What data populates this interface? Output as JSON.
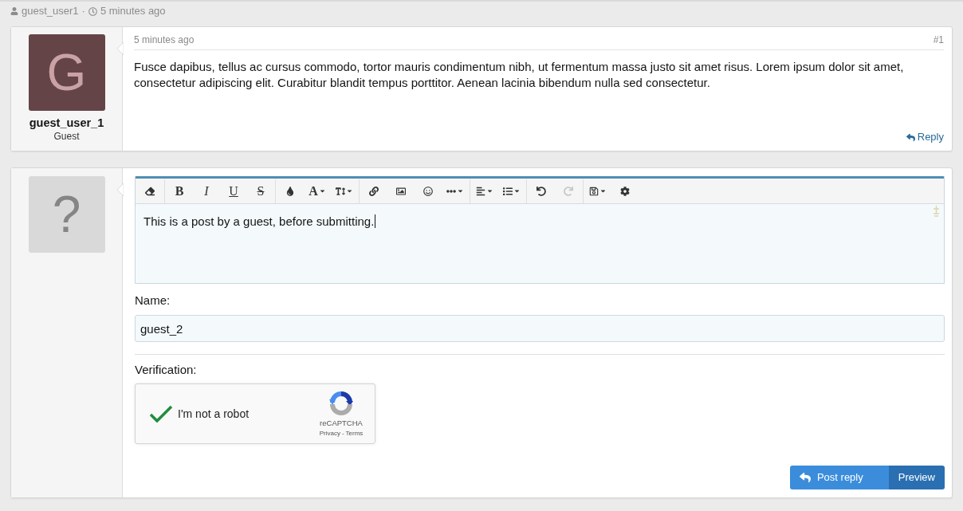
{
  "thread_meta": {
    "author": "guest_user1",
    "separator": "·",
    "time": "5 minutes ago"
  },
  "posts": [
    {
      "avatar_letter": "G",
      "username": "guest_user_1",
      "user_title": "Guest",
      "time": "5 minutes ago",
      "number": "#1",
      "body": "Fusce dapibus, tellus ac cursus commodo, tortor mauris condimentum nibh, ut fermentum massa justo sit amet risus. Lorem ipsum dolor sit amet, consectetur adipiscing elit. Curabitur blandit tempus porttitor. Aenean lacinia bibendum nulla sed consectetur.",
      "reply_link": "Reply"
    }
  ],
  "reply_form": {
    "avatar_placeholder": "?",
    "toolbar": [
      [
        {
          "dropdown": false,
          "disabled": false
        }
      ],
      [
        {
          "label": "B",
          "dropdown": false,
          "disabled": false
        },
        {
          "label": "I",
          "dropdown": false,
          "disabled": false
        },
        {
          "label": "U",
          "dropdown": false,
          "disabled": false
        },
        {
          "label": "S",
          "dropdown": false,
          "disabled": false
        }
      ],
      [
        {
          "dropdown": false,
          "disabled": false
        },
        {
          "label": "A",
          "dropdown": true,
          "disabled": false
        },
        {
          "dropdown": true,
          "disabled": false
        }
      ],
      [
        {
          "dropdown": false,
          "disabled": false
        },
        {
          "dropdown": false,
          "disabled": false
        },
        {
          "dropdown": false,
          "disabled": false
        },
        {
          "dropdown": true,
          "disabled": false
        }
      ],
      [
        {
          "dropdown": true,
          "disabled": false
        },
        {
          "dropdown": true,
          "disabled": false
        }
      ],
      [
        {
          "dropdown": false,
          "disabled": false
        },
        {
          "dropdown": false,
          "disabled": true
        }
      ],
      [
        {
          "dropdown": true,
          "disabled": false
        },
        {
          "dropdown": false,
          "disabled": false
        }
      ]
    ],
    "editor_text": "This is a post by a guest, before submitting.",
    "name_label": "Name:",
    "name_value": "guest_2",
    "verification_label": "Verification:",
    "captcha": {
      "checked": true,
      "label": "I'm not a robot",
      "brand": "reCAPTCHA",
      "links": [
        "Privacy",
        "Terms"
      ],
      "link_separator": "-"
    },
    "buttons": [
      {
        "label": "Post reply",
        "kind": "primary"
      },
      {
        "label": "Preview",
        "kind": "secondary"
      }
    ]
  }
}
